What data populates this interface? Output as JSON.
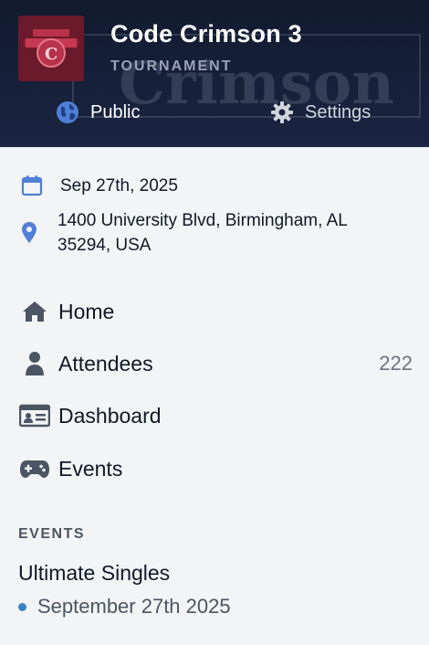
{
  "header": {
    "title": "Code Crimson 3",
    "subtitle": "TOURNAMENT",
    "visibility_label": "Public",
    "settings_label": "Settings",
    "background_text": "Crimson"
  },
  "info": {
    "date": "Sep 27th, 2025",
    "location": "1400 University Blvd, Birmingham, AL 35294, USA"
  },
  "nav": {
    "home": "Home",
    "attendees": "Attendees",
    "attendees_count": "222",
    "dashboard": "Dashboard",
    "events": "Events"
  },
  "events_section": {
    "label": "EVENTS",
    "items": [
      {
        "name": "Ultimate Singles",
        "date": "September 27th 2025"
      }
    ]
  },
  "colors": {
    "header_bg": "#16203a",
    "accent_blue": "#4f7fd6",
    "logo_bg": "#6b1a2b",
    "dot_blue": "#3b82c4"
  }
}
